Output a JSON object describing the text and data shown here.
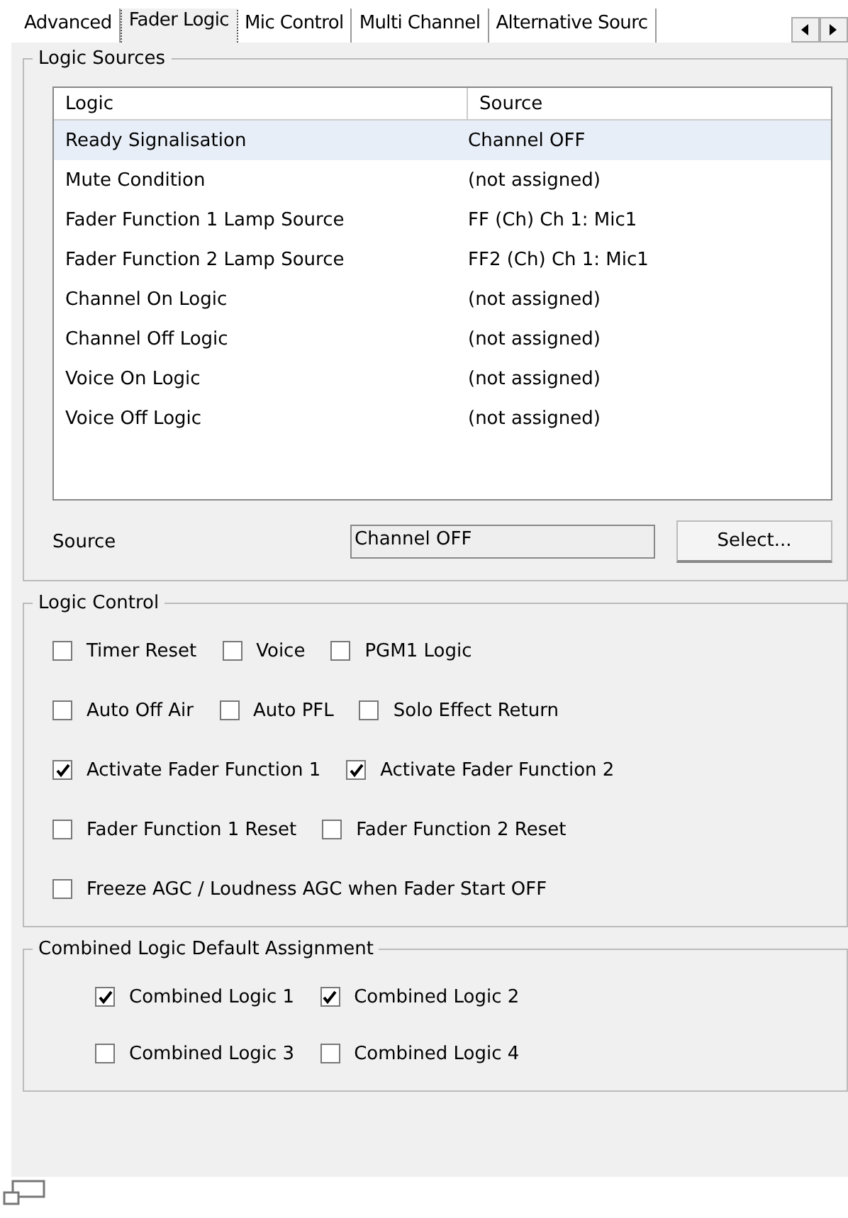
{
  "tabs": [
    {
      "label": "Advanced",
      "selected": false
    },
    {
      "label": "Fader Logic",
      "selected": true
    },
    {
      "label": "Mic Control",
      "selected": false
    },
    {
      "label": "Multi Channel",
      "selected": false
    },
    {
      "label": "Alternative Sourc",
      "selected": false
    }
  ],
  "logic_sources": {
    "title": "Logic Sources",
    "columns": [
      "Logic",
      "Source"
    ],
    "rows": [
      {
        "logic": "Ready Signalisation",
        "source": "Channel OFF",
        "selected": true
      },
      {
        "logic": "Mute Condition",
        "source": "(not assigned)",
        "selected": false
      },
      {
        "logic": "Fader Function 1 Lamp Source",
        "source": "FF (Ch) Ch 1: Mic1",
        "selected": false
      },
      {
        "logic": "Fader Function 2 Lamp Source",
        "source": "FF2 (Ch) Ch 1: Mic1",
        "selected": false
      },
      {
        "logic": "Channel On Logic",
        "source": "(not assigned)",
        "selected": false
      },
      {
        "logic": "Channel Off Logic",
        "source": "(not assigned)",
        "selected": false
      },
      {
        "logic": "Voice On Logic",
        "source": "(not assigned)",
        "selected": false
      },
      {
        "logic": "Voice Off Logic",
        "source": "(not assigned)",
        "selected": false
      }
    ],
    "source_label": "Source",
    "source_value": "Channel OFF",
    "select_button": "Select..."
  },
  "logic_control": {
    "title": "Logic Control",
    "rows": [
      [
        {
          "label": "Timer Reset",
          "checked": false
        },
        {
          "label": "Voice",
          "checked": false
        },
        {
          "label": "PGM1 Logic",
          "checked": false
        }
      ],
      [
        {
          "label": "Auto Off Air",
          "checked": false
        },
        {
          "label": "Auto PFL",
          "checked": false
        },
        {
          "label": "Solo Effect Return",
          "checked": false
        }
      ],
      [
        {
          "label": "Activate Fader Function 1",
          "checked": true
        },
        {
          "label": "Activate Fader Function 2",
          "checked": true
        }
      ],
      [
        {
          "label": "Fader Function 1 Reset",
          "checked": false
        },
        {
          "label": "Fader Function 2 Reset",
          "checked": false
        }
      ],
      [
        {
          "label": "Freeze AGC / Loudness AGC when Fader Start OFF",
          "checked": false
        }
      ]
    ]
  },
  "combined_logic": {
    "title": "Combined Logic Default Assignment",
    "rows": [
      [
        {
          "label": "Combined Logic 1",
          "checked": true
        },
        {
          "label": "Combined Logic 2",
          "checked": true
        }
      ],
      [
        {
          "label": "Combined Logic 3",
          "checked": false
        },
        {
          "label": "Combined Logic 4",
          "checked": false
        }
      ]
    ]
  }
}
